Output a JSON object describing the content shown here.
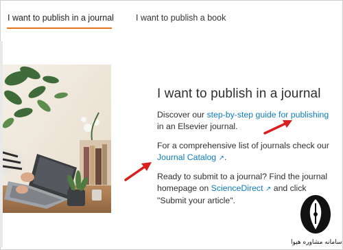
{
  "tabs": [
    {
      "label": "I want to publish in a journal",
      "active": true
    },
    {
      "label": "I want to publish a book",
      "active": false
    }
  ],
  "main": {
    "heading": "I want to publish in a journal",
    "p1": {
      "prefix": "Discover our ",
      "link": "step-by-step guide for publishing",
      "suffix": "in an Elsevier journal."
    },
    "p2": {
      "line1": "For a comprehensive list of journals check our",
      "link": "Journal Catalog",
      "ext_icon": "↗",
      "suffix": "."
    },
    "p3": {
      "line1": "Ready to submit to a journal? Find the journal",
      "prefix": "homepage on ",
      "link": "ScienceDirect",
      "ext_icon": "↗",
      "suffix": " and click",
      "line3": "\"Submit your article\"."
    }
  },
  "watermark": {
    "text": "سامانه مشاوره هپوا",
    "icon": "pen-nib-logo"
  },
  "colors": {
    "accent": "#e9711c",
    "link": "#0c7dbb",
    "annotation_arrow": "#d91f1f"
  }
}
